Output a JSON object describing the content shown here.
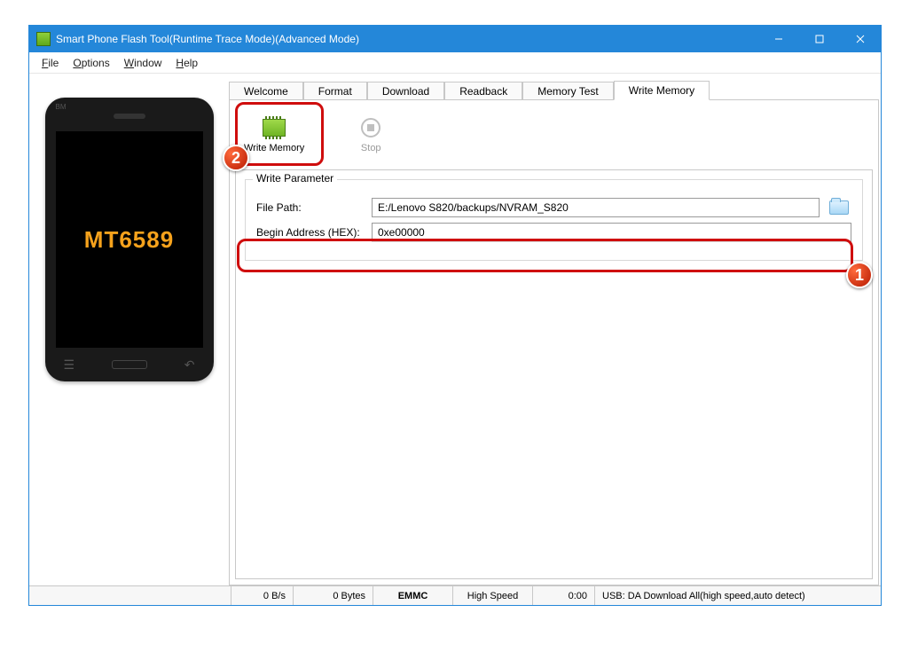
{
  "window": {
    "title": "Smart Phone Flash Tool(Runtime Trace Mode)(Advanced Mode)"
  },
  "menu": {
    "file": "File",
    "options": "Options",
    "window": "Window",
    "help": "Help"
  },
  "phone": {
    "brand": "BM",
    "chip": "MT6589"
  },
  "tabs": {
    "welcome": "Welcome",
    "format": "Format",
    "download": "Download",
    "readback": "Readback",
    "memory_test": "Memory Test",
    "write_memory": "Write Memory"
  },
  "toolbar": {
    "write_memory": "Write Memory",
    "stop": "Stop"
  },
  "group": {
    "legend": "Write Parameter",
    "file_path_label": "File Path:",
    "file_path_value": "E:/Lenovo S820/backups/NVRAM_S820",
    "begin_addr_label": "Begin Address (HEX):",
    "begin_addr_value": "0xe00000"
  },
  "status": {
    "rate": "0 B/s",
    "bytes": "0 Bytes",
    "storage": "EMMC",
    "speed": "High Speed",
    "time": "0:00",
    "usb": "USB: DA Download All(high speed,auto detect)"
  },
  "annotations": {
    "b1": "1",
    "b2": "2"
  }
}
